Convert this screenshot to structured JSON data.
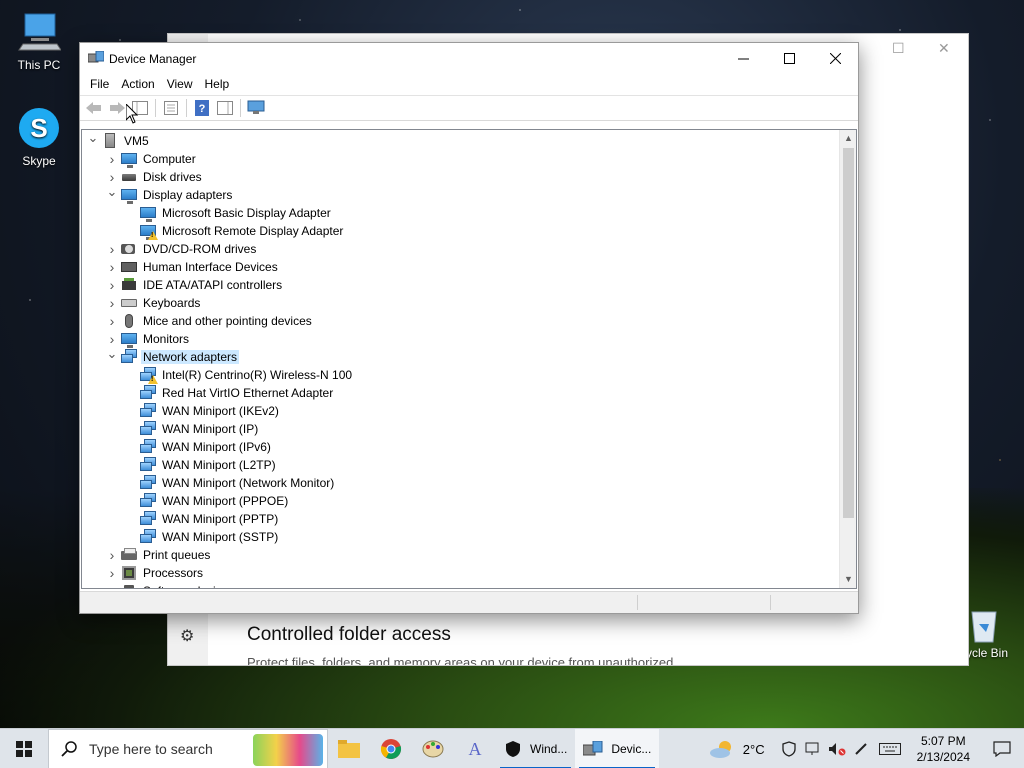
{
  "desktop": {
    "icons": [
      {
        "label": "This PC"
      },
      {
        "label": "Skype"
      },
      {
        "label": "ycle Bin"
      }
    ]
  },
  "background_window": {
    "heading": "Controlled folder access",
    "description": "Protect files, folders, and memory areas on your device from unauthorized"
  },
  "device_manager": {
    "title": "Device Manager",
    "menu": [
      "File",
      "Action",
      "View",
      "Help"
    ],
    "tree": [
      {
        "label": "VM5",
        "level": 0,
        "expanded": true,
        "icon": "computer-root-icon"
      },
      {
        "label": "Computer",
        "level": 1,
        "expanded": false,
        "icon": "monitor-icon"
      },
      {
        "label": "Disk drives",
        "level": 1,
        "expanded": false,
        "icon": "disk-drive-icon"
      },
      {
        "label": "Display adapters",
        "level": 1,
        "expanded": true,
        "icon": "display-adapter-icon"
      },
      {
        "label": "Microsoft Basic Display Adapter",
        "level": 2,
        "icon": "display-adapter-icon"
      },
      {
        "label": "Microsoft Remote Display Adapter",
        "level": 2,
        "icon": "display-adapter-warning-icon"
      },
      {
        "label": "DVD/CD-ROM drives",
        "level": 1,
        "expanded": false,
        "icon": "cd-drive-icon"
      },
      {
        "label": "Human Interface Devices",
        "level": 1,
        "expanded": false,
        "icon": "hid-icon"
      },
      {
        "label": "IDE ATA/ATAPI controllers",
        "level": 1,
        "expanded": false,
        "icon": "ide-controller-icon"
      },
      {
        "label": "Keyboards",
        "level": 1,
        "expanded": false,
        "icon": "keyboard-icon"
      },
      {
        "label": "Mice and other pointing devices",
        "level": 1,
        "expanded": false,
        "icon": "mouse-icon"
      },
      {
        "label": "Monitors",
        "level": 1,
        "expanded": false,
        "icon": "monitor-icon"
      },
      {
        "label": "Network adapters",
        "level": 1,
        "expanded": true,
        "selected": true,
        "icon": "network-adapter-icon"
      },
      {
        "label": "Intel(R) Centrino(R) Wireless-N 100",
        "level": 2,
        "icon": "network-adapter-warning-icon"
      },
      {
        "label": "Red Hat VirtIO Ethernet Adapter",
        "level": 2,
        "icon": "network-adapter-icon"
      },
      {
        "label": "WAN Miniport (IKEv2)",
        "level": 2,
        "icon": "network-adapter-icon"
      },
      {
        "label": "WAN Miniport (IP)",
        "level": 2,
        "icon": "network-adapter-icon"
      },
      {
        "label": "WAN Miniport (IPv6)",
        "level": 2,
        "icon": "network-adapter-icon"
      },
      {
        "label": "WAN Miniport (L2TP)",
        "level": 2,
        "icon": "network-adapter-icon"
      },
      {
        "label": "WAN Miniport (Network Monitor)",
        "level": 2,
        "icon": "network-adapter-icon"
      },
      {
        "label": "WAN Miniport (PPPOE)",
        "level": 2,
        "icon": "network-adapter-icon"
      },
      {
        "label": "WAN Miniport (PPTP)",
        "level": 2,
        "icon": "network-adapter-icon"
      },
      {
        "label": "WAN Miniport (SSTP)",
        "level": 2,
        "icon": "network-adapter-icon"
      },
      {
        "label": "Print queues",
        "level": 1,
        "expanded": false,
        "icon": "printer-icon"
      },
      {
        "label": "Processors",
        "level": 1,
        "expanded": false,
        "icon": "processor-icon"
      },
      {
        "label": "Software devices",
        "level": 1,
        "expanded": false,
        "icon": "software-device-icon"
      }
    ]
  },
  "taskbar": {
    "search_placeholder": "Type here to search",
    "tasks": [
      {
        "label": "Wind..."
      },
      {
        "label": "Devic..."
      }
    ],
    "weather": "2°C",
    "time": "5:07 PM",
    "date": "2/13/2024"
  }
}
